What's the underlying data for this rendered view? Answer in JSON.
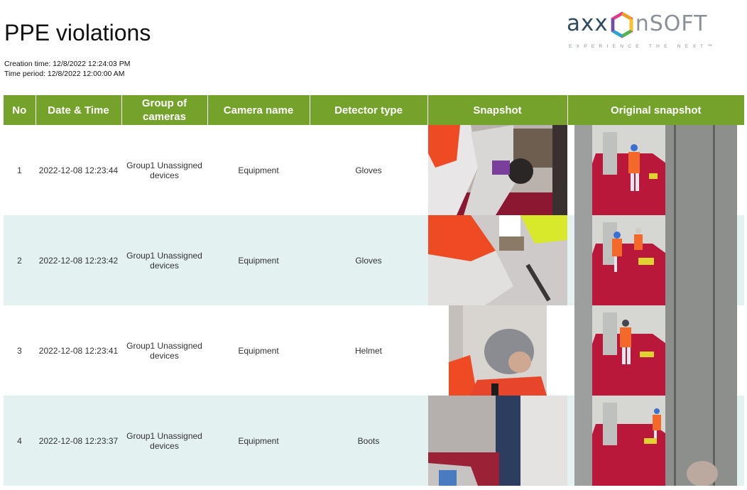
{
  "report": {
    "title": "PPE violations",
    "creation_time": "Creation time: 12/8/2022 12:24:03 PM",
    "time_period": "Time period: 12/8/2022 12:00:00 AM"
  },
  "logo": {
    "left_text": "axx",
    "right_text": "nSOFT",
    "tagline": "EXPERIENCE THE NEXT™"
  },
  "table": {
    "headers": [
      "No",
      "Date & Time",
      "Group of cameras",
      "Camera name",
      "Detector type",
      "Snapshot",
      "Original snapshot"
    ],
    "rows": [
      {
        "no": "1",
        "datetime": "2022-12-08 12:23:44",
        "group": "Group1 Unassigned devices",
        "camera": "Equipment",
        "detector": "Gloves"
      },
      {
        "no": "2",
        "datetime": "2022-12-08 12:23:42",
        "group": "Group1 Unassigned devices",
        "camera": "Equipment",
        "detector": "Gloves"
      },
      {
        "no": "3",
        "datetime": "2022-12-08 12:23:41",
        "group": "Group1 Unassigned devices",
        "camera": "Equipment",
        "detector": "Helmet"
      },
      {
        "no": "4",
        "datetime": "2022-12-08 12:23:37",
        "group": "Group1 Unassigned devices",
        "camera": "Equipment",
        "detector": "Boots"
      }
    ]
  },
  "colors": {
    "header_bg": "#74a22a",
    "alt_row_bg": "#e3f1f1"
  }
}
